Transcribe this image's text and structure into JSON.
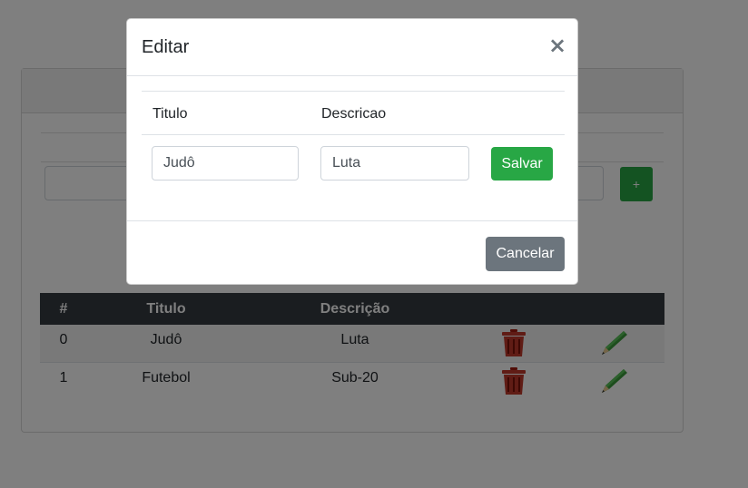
{
  "page": {
    "add_button_label": "+",
    "table": {
      "headers": [
        "#",
        "Titulo",
        "Descrição",
        "",
        ""
      ],
      "rows": [
        {
          "num": "0",
          "titulo": "Judô",
          "descricao": "Luta"
        },
        {
          "num": "1",
          "titulo": "Futebol",
          "descricao": "Sub-20"
        }
      ],
      "delete_icon": "trash-icon",
      "edit_icon": "pencil-icon"
    }
  },
  "modal": {
    "title": "Editar",
    "close_label": "×",
    "col_titulo": "Titulo",
    "col_descricao": "Descricao",
    "titulo_value": "Judô",
    "descricao_value": "Luta",
    "save_label": "Salvar",
    "cancel_label": "Cancelar"
  },
  "colors": {
    "success": "#28a745",
    "secondary": "#6c757d",
    "dark": "#343a40",
    "trash": "#c0392b",
    "pencil": "#2e8b2e"
  }
}
